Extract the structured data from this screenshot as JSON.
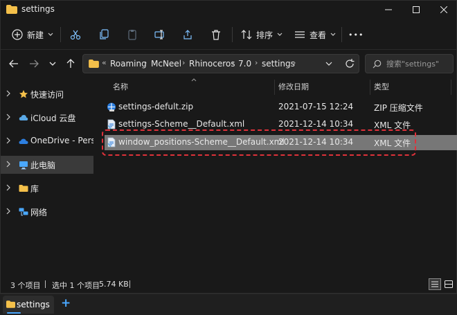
{
  "window": {
    "title": "settings",
    "controls": [
      "minimize",
      "maximize",
      "close"
    ]
  },
  "toolbar": {
    "new_label": "新建",
    "sort_label": "排序",
    "view_label": "查看",
    "more_label": "•••"
  },
  "navigation": {
    "breadcrumb": [
      "Roaming",
      "McNeel",
      "Rhinoceros",
      "7.0",
      "settings"
    ],
    "search_placeholder": "搜索\"settings\""
  },
  "sidebar": {
    "items": [
      {
        "label": "快速访问",
        "icon": "star-icon",
        "selected": false
      },
      {
        "label": "iCloud 云盘",
        "icon": "icloud-icon",
        "selected": false
      },
      {
        "label": "OneDrive - Personal",
        "icon": "onedrive-icon",
        "selected": false
      },
      {
        "label": "此电脑",
        "icon": "pc-icon",
        "selected": true
      },
      {
        "label": "库",
        "icon": "library-icon",
        "selected": false
      },
      {
        "label": "网络",
        "icon": "network-icon",
        "selected": false
      }
    ]
  },
  "file_list": {
    "columns": [
      "名称",
      "修改日期",
      "类型"
    ],
    "rows": [
      {
        "name": "settings-defult.zip",
        "date": "2021-07-15 12:24",
        "type": "ZIP 压缩文件",
        "icon": "zip-file-icon",
        "selected": false
      },
      {
        "name": "settings-Scheme__Default.xml",
        "date": "2021-12-14 10:34",
        "type": "XML 文件",
        "icon": "xml-file-icon",
        "selected": false
      },
      {
        "name": "window_positions-Scheme__Default.xml",
        "date": "2021-12-14 10:34",
        "type": "XML 文件",
        "icon": "xml-file-icon",
        "selected": true
      }
    ]
  },
  "status": {
    "count": "3 个项目",
    "selected": "选中 1 个项目",
    "size": "5.74 KB"
  },
  "taskbar": {
    "tab_label": "settings",
    "add_tab": "+"
  },
  "colors": {
    "background": "#191919",
    "selection": "#777777",
    "highlight_border": "#e0313a",
    "accent": "#4aa8ff",
    "folder": "#f4c04a"
  }
}
